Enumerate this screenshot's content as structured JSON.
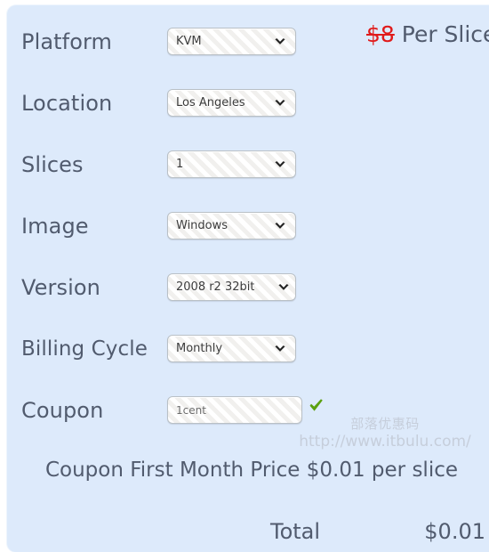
{
  "panel": {
    "background_color": "#ddeafb",
    "label_color": "#515b6e"
  },
  "price_note": {
    "struck_price": "$8",
    "suffix": " Per Slice",
    "struck_color": "#e01b1b"
  },
  "form": {
    "rows": [
      {
        "label": "Platform",
        "control": "select",
        "value": "KVM",
        "name": "platform"
      },
      {
        "label": "Location",
        "control": "select",
        "value": "Los Angeles",
        "name": "location"
      },
      {
        "label": "Slices",
        "control": "select",
        "value": "1",
        "name": "slices"
      },
      {
        "label": "Image",
        "control": "select",
        "value": "Windows",
        "name": "image"
      },
      {
        "label": "Version",
        "control": "select",
        "value": "2008 r2 32bit",
        "name": "version"
      },
      {
        "label": "Billing Cycle",
        "control": "select",
        "value": "Monthly",
        "name": "billing-cycle"
      },
      {
        "label": "Coupon",
        "control": "text",
        "value": "1cent",
        "placeholder": "",
        "name": "coupon"
      }
    ]
  },
  "coupon_status": {
    "icon": "check-icon",
    "valid": true,
    "color": "#5ba00f"
  },
  "watermark": {
    "line1": "部落优惠码",
    "line2": "http://www.itbulu.com/",
    "color": "#c6cedb"
  },
  "summary": {
    "coupon_note": "Coupon First Month Price $0.01 per slice",
    "total_label": "Total",
    "total_value": "$0.01"
  },
  "icons": {
    "caret": "chevron-down-icon"
  }
}
